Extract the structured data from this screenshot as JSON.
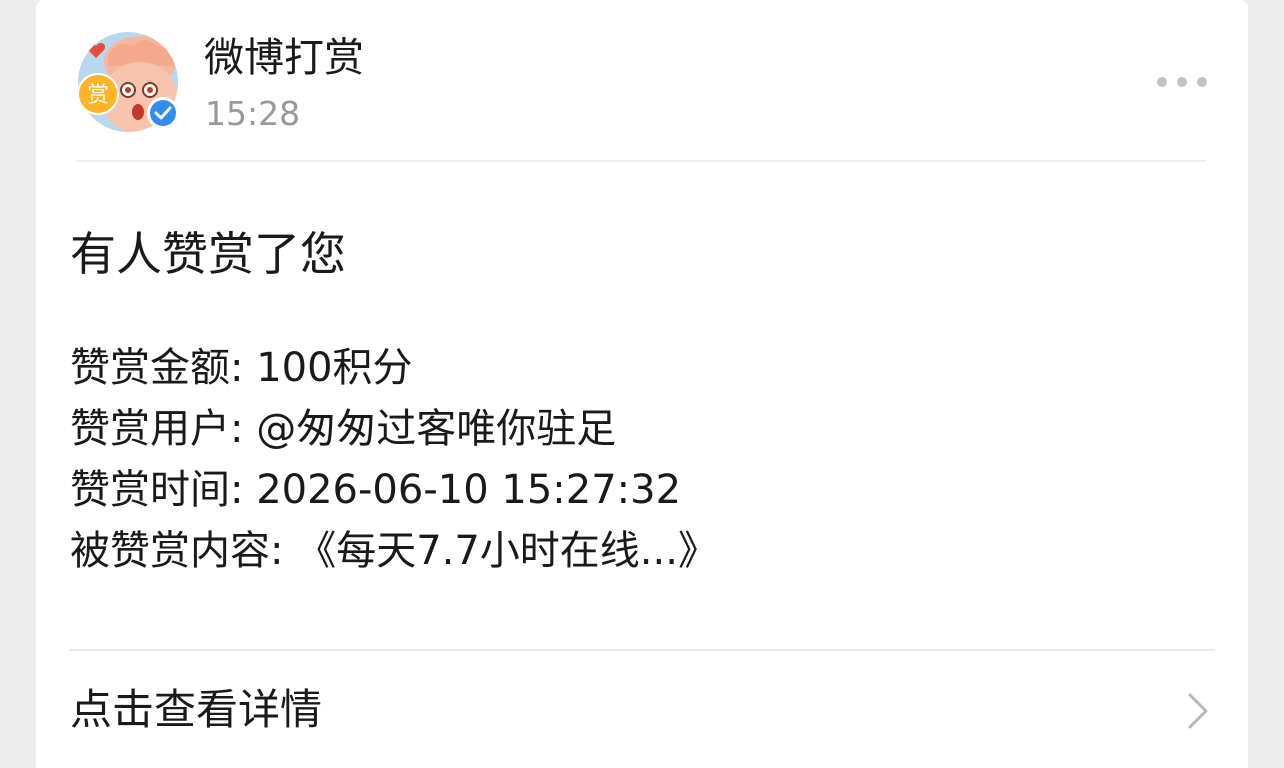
{
  "card": {
    "sender": {
      "name": "微博打赏",
      "time": "15:28",
      "avatar_badge": "赏",
      "avatar_icon": "cartoon-avatar",
      "verified_icon": "verified-check-icon"
    },
    "more_icon": "more-dots-icon",
    "title": "有人赞赏了您",
    "details": [
      "赞赏金额: 100积分",
      "赞赏用户: @匆匆过客唯你驻足",
      "赞赏时间: 2026-06-10 15:27:32",
      "被赞赏内容: 《每天7.7小时在线...》"
    ],
    "action": {
      "label": "点击查看详情",
      "icon": "chevron-right-icon"
    }
  },
  "colors": {
    "background": "#ededed",
    "card": "#ffffff",
    "text": "#1a1a1a",
    "muted": "#999999",
    "verified": "#2f8cf0",
    "badge": "#ffb423"
  }
}
